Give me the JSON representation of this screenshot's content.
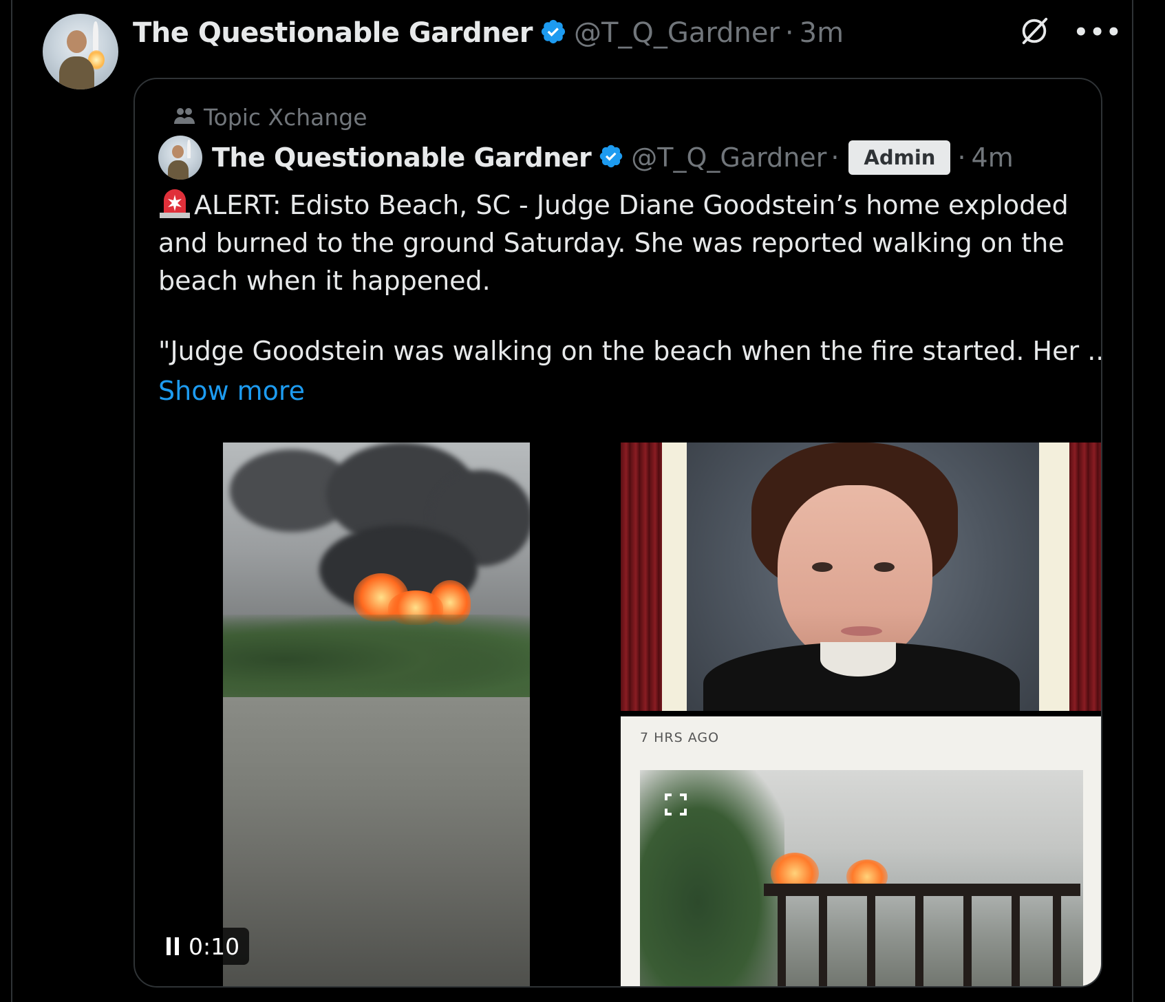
{
  "post": {
    "author_name": "The Questionable Gardner",
    "author_handle": "@T_Q_Gardner",
    "separator": "·",
    "time": "3m",
    "more_label": "•••"
  },
  "quote": {
    "community": "Topic Xchange",
    "author_name": "The Questionable Gardner",
    "author_handle": "@T_Q_Gardner",
    "separator": "·",
    "badge": "Admin",
    "time": "4m",
    "text_lines": [
      "ALERT: Edisto Beach, SC - Judge Diane Goodstein’s home exploded",
      "and burned to the ground Saturday. She was reported walking on the",
      "beach when it happened.",
      "\"Judge Goodstein was walking on the beach when the fire started. Her ..."
    ],
    "show_more": "Show more"
  },
  "media": {
    "video_timer": "0:10",
    "article_timestamp": "7 HRS AGO"
  },
  "colors": {
    "background": "#000000",
    "text_primary": "#e7e9ea",
    "text_secondary": "#71767b",
    "link": "#1d9bf0",
    "verified": "#1d9bf0",
    "border": "#2f3336"
  },
  "icons": {
    "verified": "verified-badge-icon",
    "grok": "grok-icon",
    "more": "more-icon",
    "community": "community-icon",
    "siren": "siren-emoji-icon",
    "pause": "pause-icon",
    "expand": "expand-icon"
  }
}
